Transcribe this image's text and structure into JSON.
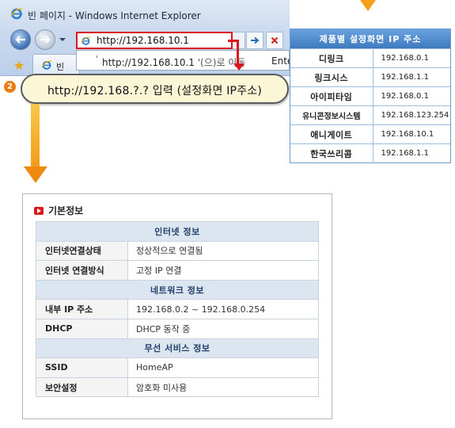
{
  "browser": {
    "window_title": "빈 페이지 - Windows Internet Explorer",
    "address_value": "http://192.168.10.1",
    "suggestion": {
      "quote": "'",
      "url": "http://192.168.10.1",
      "suffix": "'(으)로 이동",
      "enter_hint": "Ente"
    },
    "tab_label": "빈"
  },
  "step": {
    "number": "2",
    "instruction": "http://192.168.?.? 입력 (설정화면 IP주소)"
  },
  "ip_table": {
    "header": "제품별 설정화면 IP 주소",
    "rows": [
      {
        "vendor": "디링크",
        "ip": "192.168.0.1"
      },
      {
        "vendor": "링크시스",
        "ip": "192.168.1.1"
      },
      {
        "vendor": "아이피타임",
        "ip": "192.168.0.1"
      },
      {
        "vendor": "유니콘정보시스템",
        "ip": "192.168.123.254"
      },
      {
        "vendor": "애니게이트",
        "ip": "192.168.10.1"
      },
      {
        "vendor": "한국쓰리콤",
        "ip": "192.168.1.1"
      }
    ]
  },
  "basic_info": {
    "title": "기본정보",
    "sections": [
      {
        "heading": "인터넷 정보",
        "rows": [
          {
            "label": "인터넷연결상태",
            "value": "정상적으로 연결됨"
          },
          {
            "label": "인터넷 연결방식",
            "value": "고정 IP 연결"
          }
        ]
      },
      {
        "heading": "네트워크 정보",
        "rows": [
          {
            "label": "내부 IP 주소",
            "value": "192.168.0.2 ~ 192.168.0.254"
          },
          {
            "label": "DHCP",
            "value": "DHCP 동작 중"
          }
        ]
      },
      {
        "heading": "무선 서비스 정보",
        "rows": [
          {
            "label": "SSID",
            "value": "HomeAP"
          },
          {
            "label": "보안설정",
            "value": "암호화 미사용"
          }
        ]
      }
    ]
  },
  "colors": {
    "highlight_red": "#d9171d",
    "arrow_orange": "#f29b18",
    "table_header_blue": "#3e7ac0",
    "section_blue": "#dce6f0"
  },
  "icons": [
    "ie-logo-icon",
    "back-arrow-icon",
    "forward-arrow-icon",
    "go-arrow-icon",
    "stop-x-icon",
    "favorites-star-icon",
    "red-play-icon"
  ]
}
